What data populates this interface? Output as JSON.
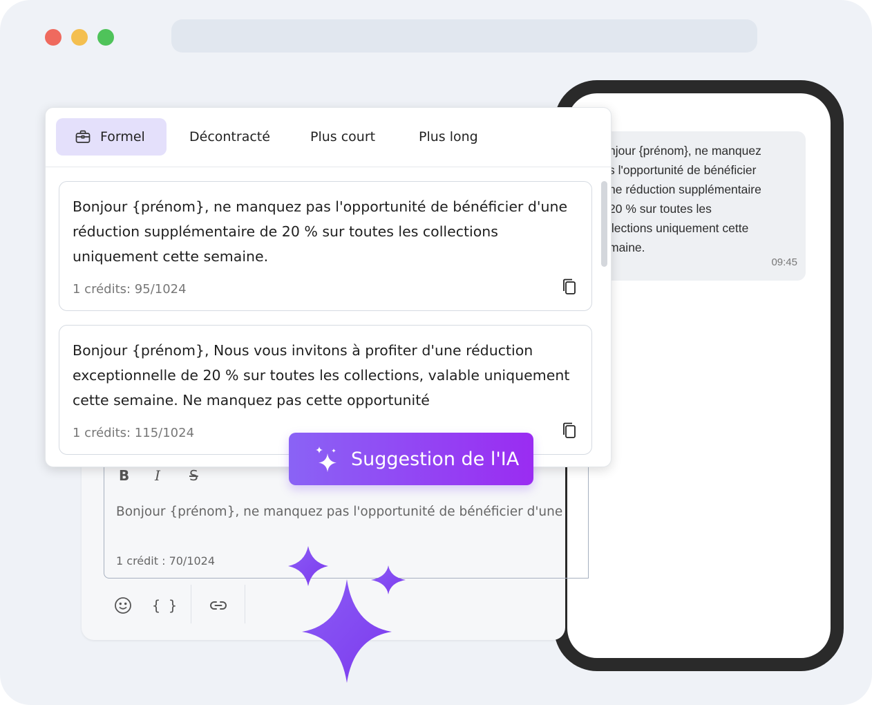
{
  "window": {
    "colors": {
      "background": "#eff2f7",
      "red": "#ef6a5e",
      "yellow": "#f4bf4f",
      "green": "#4fc35a"
    }
  },
  "phone": {
    "message_lines": "njour {prénom}, ne manquez\ns l'opportunité de bénéficier\nne réduction supplémentaire\n20 % sur toutes les\nllections uniquement cette\nmaine.",
    "time": "09:45"
  },
  "popup": {
    "tabs": [
      {
        "label": "Formel",
        "icon": "briefcase-icon",
        "active": true
      },
      {
        "label": "Décontracté"
      },
      {
        "label": "Plus court"
      },
      {
        "label": "Plus long"
      }
    ],
    "suggestions": [
      {
        "text": "Bonjour {prénom}, ne manquez pas l'opportunité de bénéficier d'une réduction supplémentaire de 20 % sur toutes les collections uniquement cette semaine.",
        "credits": "1 crédits: 95/1024"
      },
      {
        "text": "Bonjour {prénom}, Nous vous invitons à profiter d'une réduction exceptionnelle de 20 % sur toutes les collections, valable uniquement cette semaine. Ne manquez pas cette opportunité",
        "credits": "1 crédits: 115/1024"
      }
    ]
  },
  "ai_button": {
    "label": "Suggestion de l'IA",
    "icon": "sparkles-icon",
    "colors": [
      "#8a63f5",
      "#9a2cf2"
    ]
  },
  "editor": {
    "format": {
      "bold": "B",
      "italic": "I",
      "strike": "S"
    },
    "text": "Bonjour {prénom}, ne manquez pas l'opportunité de bénéficier d'une",
    "credit": "1 crédit : 70/1024",
    "tools": {
      "emoji": "emoji-icon",
      "braces": "{ }",
      "link": "link-icon"
    }
  }
}
